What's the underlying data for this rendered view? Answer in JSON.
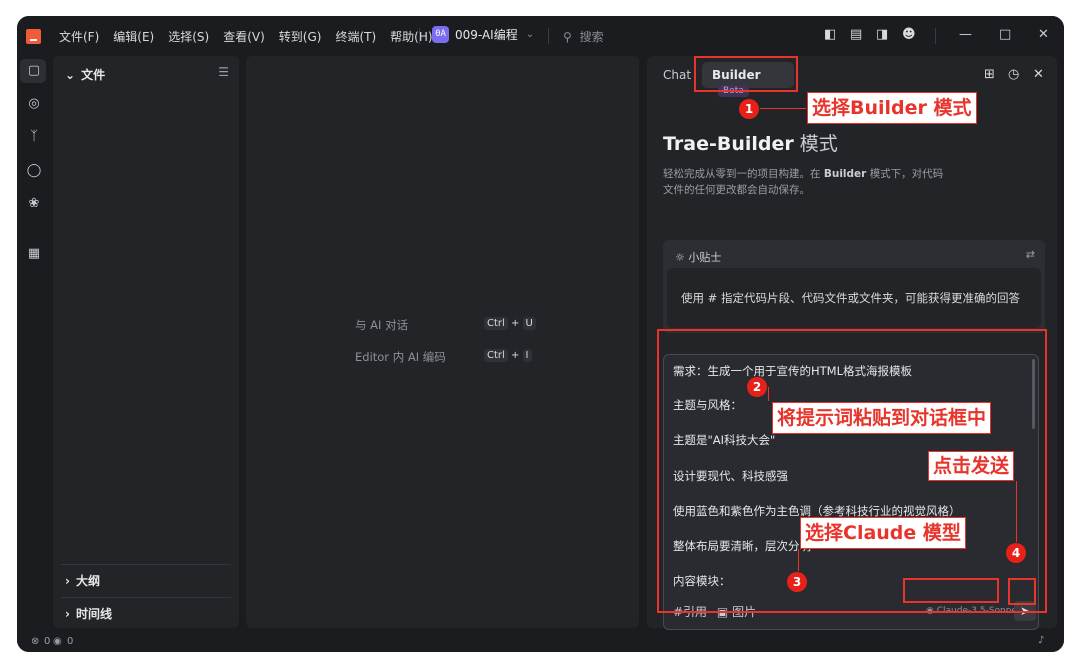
{
  "titlebar": {
    "menu": [
      "文件(F)",
      "编辑(E)",
      "选择(S)",
      "查看(V)",
      "转到(G)",
      "终端(T)",
      "帮助(H)"
    ],
    "project_badge": "0A",
    "project_name": "009-AI编程",
    "search_placeholder": "搜索"
  },
  "files_panel": {
    "title": "文件",
    "outline": "大纲",
    "timeline": "时间线"
  },
  "editor": {
    "hints": [
      {
        "label": "与 AI 对话",
        "keys": [
          "Ctrl",
          "U"
        ]
      },
      {
        "label": "Editor 内 AI 编码",
        "keys": [
          "Ctrl",
          "I"
        ]
      }
    ]
  },
  "chat": {
    "tab_chat": "Chat",
    "tab_builder": "Builder",
    "beta": "Beta",
    "title": "Trae-Builder",
    "title_mode": "模式",
    "desc_1": "轻松完成从零到一的项目构建。在",
    "desc_builder": "Builder",
    "desc_2": "模式下，对代码文件的任何更改都会自动保存。",
    "tips_title": "小贴士",
    "tips_body": "使用 # 指定代码片段、代码文件或文件夹，可能获得更准确的回答",
    "prompt_lines": [
      "需求：生成一个用于宣传的HTML格式海报模板",
      "主题与风格：",
      "主题是\"AI科技大会\"",
      "设计要现代、科技感强",
      "使用蓝色和紫色作为主色调（参考科技行业的视觉风格）",
      "整体布局要清晰，层次分明",
      "内容模块："
    ],
    "cite": "#引用",
    "image": "图片",
    "model": "Claude-3.5-Sonnet"
  },
  "statusbar": {
    "errors": "0",
    "warnings": "0"
  },
  "annotations": {
    "a1": "选择Builder 模式",
    "a2": "将提示词粘贴到对话框中",
    "a3": "选择Claude 模型",
    "a4": "点击发送",
    "n1": "1",
    "n2": "2",
    "n3": "3",
    "n4": "4"
  },
  "colors": {
    "accent_red": "#e8352c",
    "beta_purple": "#c39dfc",
    "project_badge": "#7b6cf0"
  }
}
